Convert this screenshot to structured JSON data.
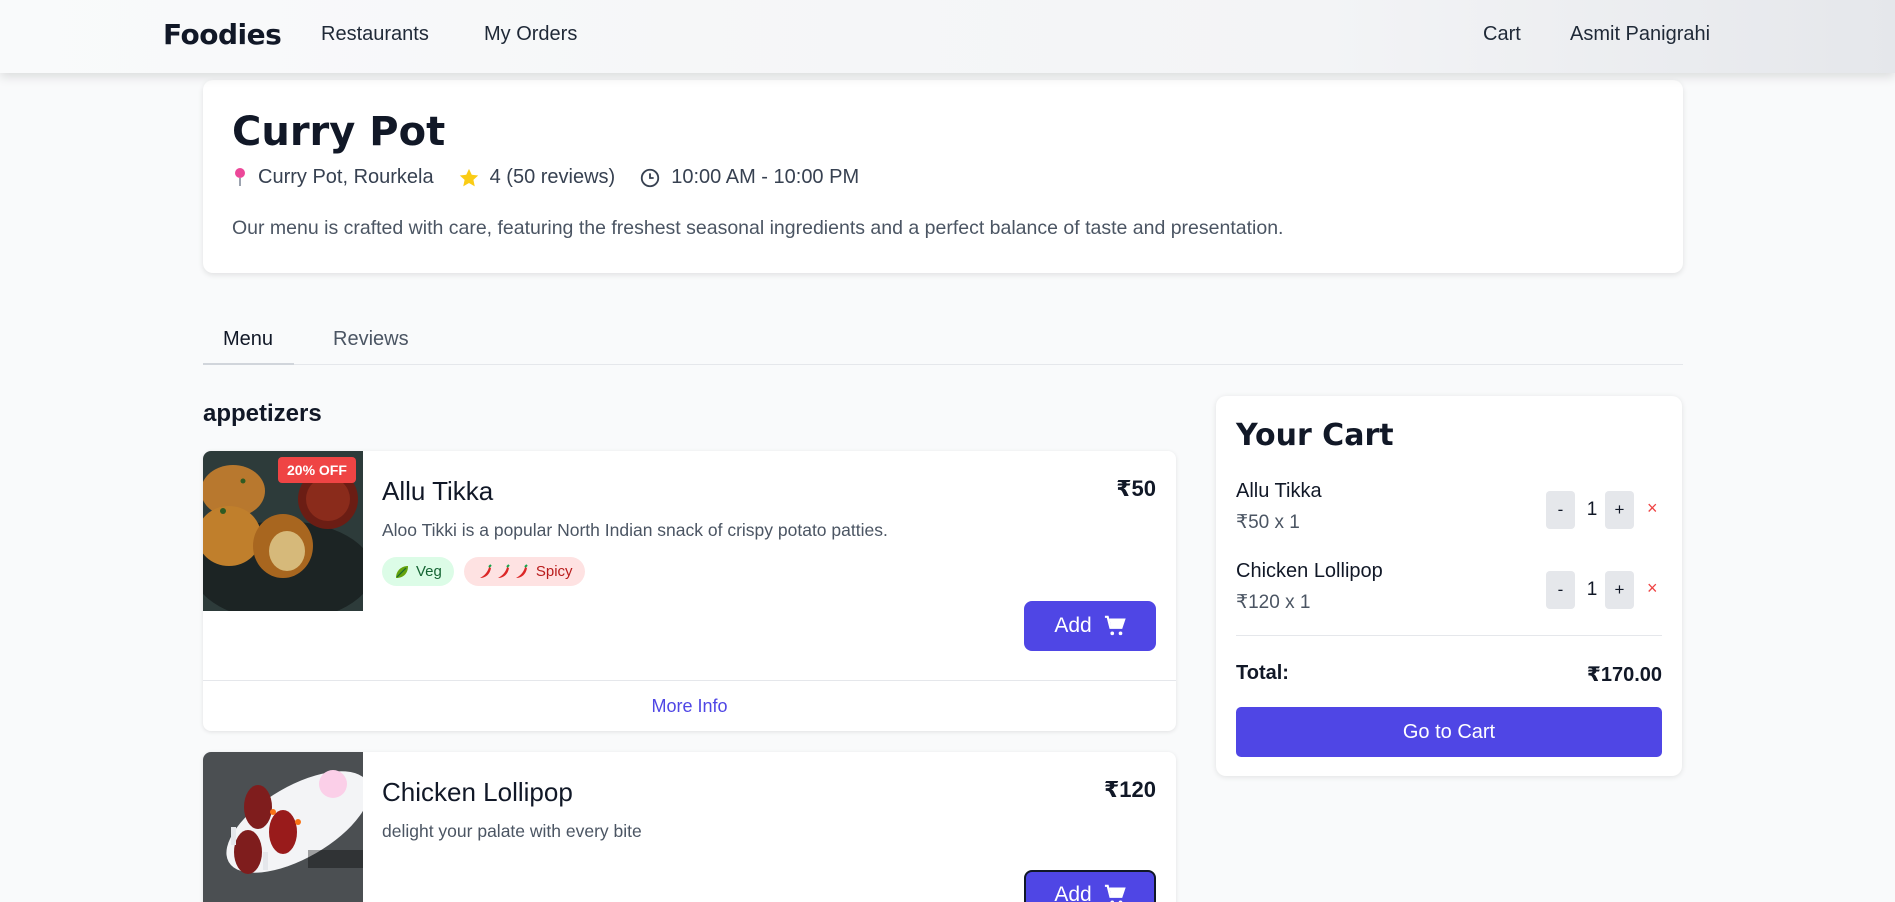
{
  "navbar": {
    "brand": "Foodies",
    "links": [
      "Restaurants",
      "My Orders"
    ],
    "cart": "Cart",
    "user": "Asmit Panigrahi"
  },
  "restaurant": {
    "name": "Curry Pot",
    "location": "Curry Pot, Rourkela",
    "rating": "4 (50 reviews)",
    "hours": "10:00 AM - 10:00 PM",
    "description": "Our menu is crafted with care, featuring the freshest seasonal ingredients and a perfect balance of taste and presentation."
  },
  "tabs": {
    "menu": "Menu",
    "reviews": "Reviews"
  },
  "category": "appetizers",
  "items": [
    {
      "name": "Allu Tikka",
      "price": "₹50",
      "discount": "20% OFF",
      "description": "Aloo Tikki is a popular North Indian snack of crispy potato patties.",
      "tags": {
        "veg": "Veg",
        "spicy": "Spicy"
      },
      "add_label": "Add",
      "more_info": "More Info"
    },
    {
      "name": "Chicken Lollipop",
      "price": "₹120",
      "description": "delight your palate with every bite",
      "add_label": "Add"
    }
  ],
  "cart": {
    "title": "Your Cart",
    "items": [
      {
        "name": "Allu Tikka",
        "sub": "₹50 x 1",
        "qty": "1"
      },
      {
        "name": "Chicken Lollipop",
        "sub": "₹120 x 1",
        "qty": "1"
      }
    ],
    "minus": "-",
    "plus": "+",
    "remove": "×",
    "total_label": "Total:",
    "total_value": "₹170.00",
    "button": "Go to Cart"
  },
  "colors": {
    "accent": "#4f46e5",
    "discount": "#ef4444",
    "veg_bg": "#dcfce7",
    "spicy_bg": "#fee2e2"
  }
}
